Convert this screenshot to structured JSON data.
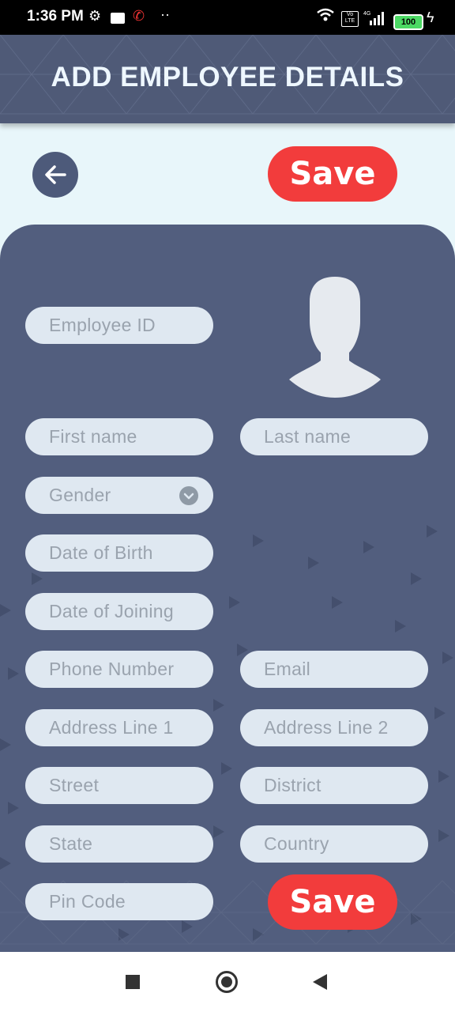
{
  "status_bar": {
    "time": "1:36 PM",
    "battery": "100"
  },
  "header": {
    "title": "ADD EMPLOYEE DETAILS"
  },
  "actions": {
    "save_top": "Save",
    "save_bottom": "Save"
  },
  "form": {
    "employee_id": "Employee ID",
    "first_name": "First name",
    "last_name": "Last name",
    "gender": "Gender",
    "dob": "Date of Birth",
    "doj": "Date of Joining",
    "phone": "Phone Number",
    "email": "Email",
    "address1": "Address Line 1",
    "address2": "Address Line 2",
    "street": "Street",
    "district": "District",
    "state": "State",
    "country": "Country",
    "pin": "Pin Code"
  },
  "colors": {
    "accent": "#f23c3c",
    "card": "#525e7e",
    "field": "#dfe8f1",
    "background": "#e8f6fa"
  }
}
